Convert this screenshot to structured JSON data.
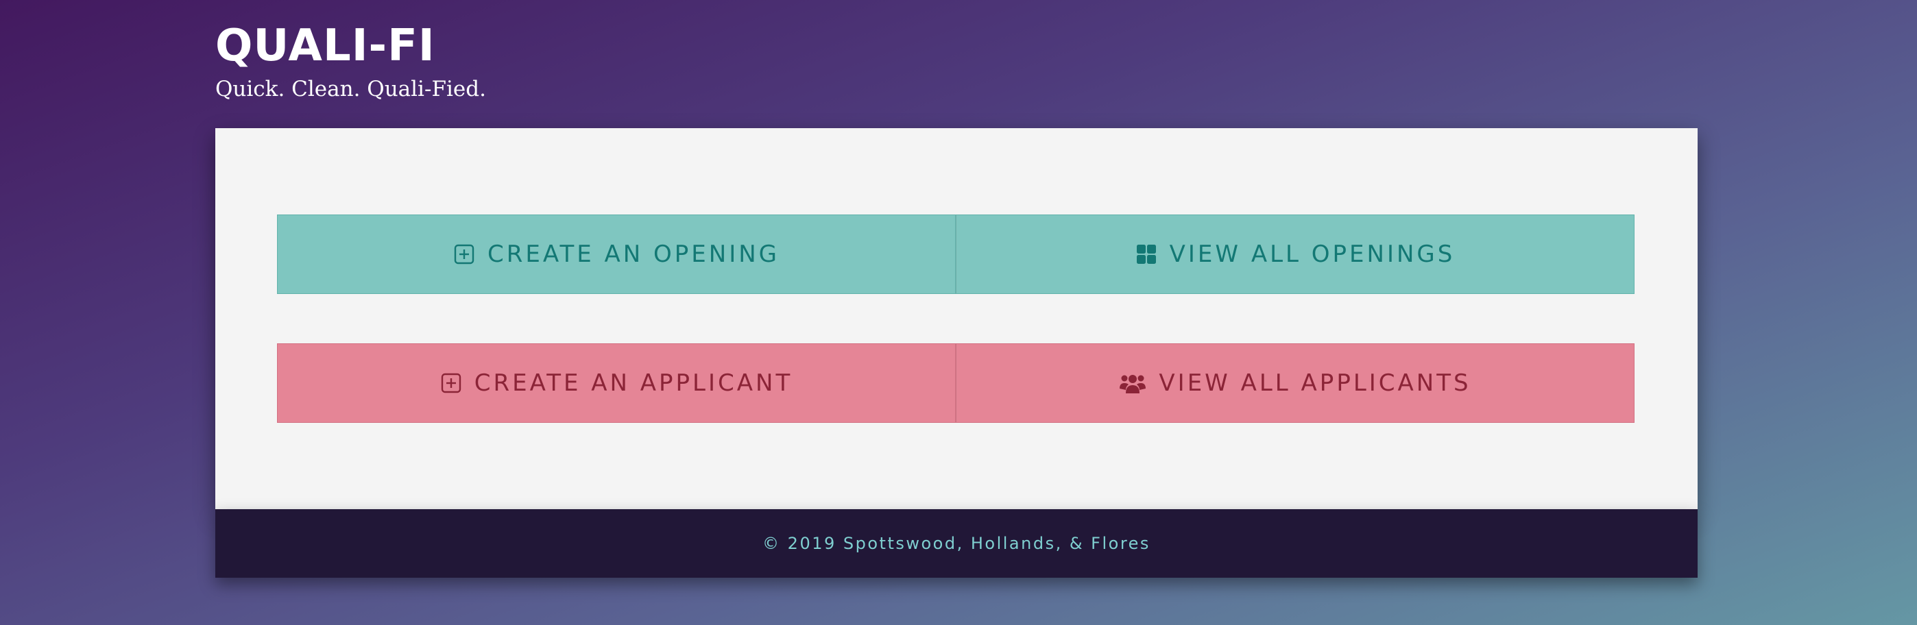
{
  "brand": {
    "title": "QUALI-FI",
    "tagline": "Quick. Clean. Quali-Fied."
  },
  "buttons": {
    "create_opening": {
      "label": "CREATE AN OPENING",
      "icon": "plus-square-icon"
    },
    "view_openings": {
      "label": "VIEW ALL OPENINGS",
      "icon": "grid-icon"
    },
    "create_applicant": {
      "label": "CREATE AN APPLICANT",
      "icon": "plus-square-icon"
    },
    "view_applicants": {
      "label": "VIEW ALL APPLICANTS",
      "icon": "users-icon"
    }
  },
  "colors": {
    "teal_bg": "#7fc6c0",
    "teal_text": "#137874",
    "pink_bg": "#e58596",
    "pink_text": "#8b2437",
    "footer_bg": "#211737",
    "footer_text": "#7fcfd0"
  },
  "footer": {
    "copyright": "© 2019 Spottswood, Hollands, & Flores"
  }
}
